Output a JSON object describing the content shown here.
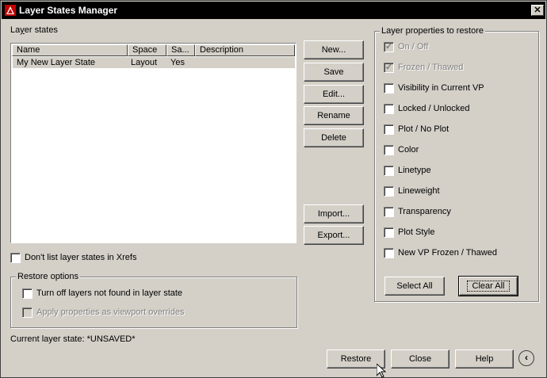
{
  "window": {
    "title": "Layer States Manager",
    "close_glyph": "✕"
  },
  "layer_states": {
    "label": "Layer states",
    "columns": [
      "Name",
      "Space",
      "Sa...",
      "Description"
    ],
    "rows": [
      {
        "name": "My New Layer State",
        "space": "Layout",
        "saved": "Yes",
        "description": ""
      }
    ]
  },
  "buttons": {
    "new": "New...",
    "save": "Save",
    "edit": "Edit...",
    "rename": "Rename",
    "delete": "Delete",
    "import": "Import...",
    "export": "Export...",
    "restore": "Restore",
    "close": "Close",
    "help": "Help",
    "select_all": "Select All",
    "clear_all": "Clear All",
    "chevron": "‹"
  },
  "dont_list_xrefs": {
    "label": "Don't list layer states in Xrefs",
    "checked": false
  },
  "restore_options": {
    "title": "Restore options",
    "turn_off_layers": {
      "label": "Turn off layers not found in layer state",
      "checked": false
    },
    "apply_viewport": {
      "label": "Apply properties as viewport overrides",
      "checked": false,
      "disabled": true
    }
  },
  "current_state": "Current layer state: *UNSAVED*",
  "properties": {
    "title": "Layer properties to restore",
    "items": [
      {
        "label": "On / Off",
        "checked": true,
        "disabled": true
      },
      {
        "label": "Frozen / Thawed",
        "checked": true,
        "disabled": true
      },
      {
        "label": "Visibility in Current VP",
        "checked": false,
        "disabled": false
      },
      {
        "label": "Locked / Unlocked",
        "checked": false,
        "disabled": false
      },
      {
        "label": "Plot / No Plot",
        "checked": false,
        "disabled": false
      },
      {
        "label": "Color",
        "checked": false,
        "disabled": false
      },
      {
        "label": "Linetype",
        "checked": false,
        "disabled": false
      },
      {
        "label": "Lineweight",
        "checked": false,
        "disabled": false
      },
      {
        "label": "Transparency",
        "checked": false,
        "disabled": false
      },
      {
        "label": "Plot Style",
        "checked": false,
        "disabled": false
      },
      {
        "label": "New VP Frozen / Thawed",
        "checked": false,
        "disabled": false
      }
    ]
  }
}
